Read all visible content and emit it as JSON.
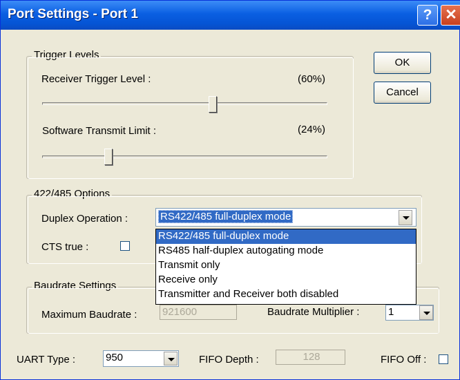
{
  "window": {
    "title": "Port Settings - Port 1",
    "help_glyph": "?",
    "close_glyph": "✕"
  },
  "buttons": {
    "ok": "OK",
    "cancel": "Cancel"
  },
  "trigger_levels": {
    "legend": "Trigger Levels",
    "receiver_label": "Receiver Trigger Level :",
    "receiver_value": "(60%)",
    "receiver_level": 0.6,
    "software_label": "Software Transmit Limit :",
    "software_value": "(24%)",
    "software_level": 0.24
  },
  "options_422_485": {
    "legend": "422/485 Options",
    "duplex_label": "Duplex Operation :",
    "duplex_selected": "RS422/485 full-duplex mode",
    "duplex_options": [
      "RS422/485 full-duplex mode",
      "RS485 half-duplex autogating mode",
      "Transmit only",
      "Receive only",
      "Transmitter and Receiver both disabled"
    ],
    "cts_label": "CTS true :"
  },
  "baudrate": {
    "legend": "Baudrate Settings",
    "max_label": "Maximum Baudrate :",
    "max_value": "921600",
    "multiplier_label": "Baudrate Multiplier :",
    "multiplier_value": "1"
  },
  "bottom": {
    "uart_label": "UART Type :",
    "uart_value": "950",
    "fifo_depth_label": "FIFO Depth :",
    "fifo_depth_value": "128",
    "fifo_off_label": "FIFO Off :"
  },
  "colors": {
    "titlebar": "#0a5fe2",
    "selection": "#316ac5",
    "face": "#ece9d8"
  }
}
